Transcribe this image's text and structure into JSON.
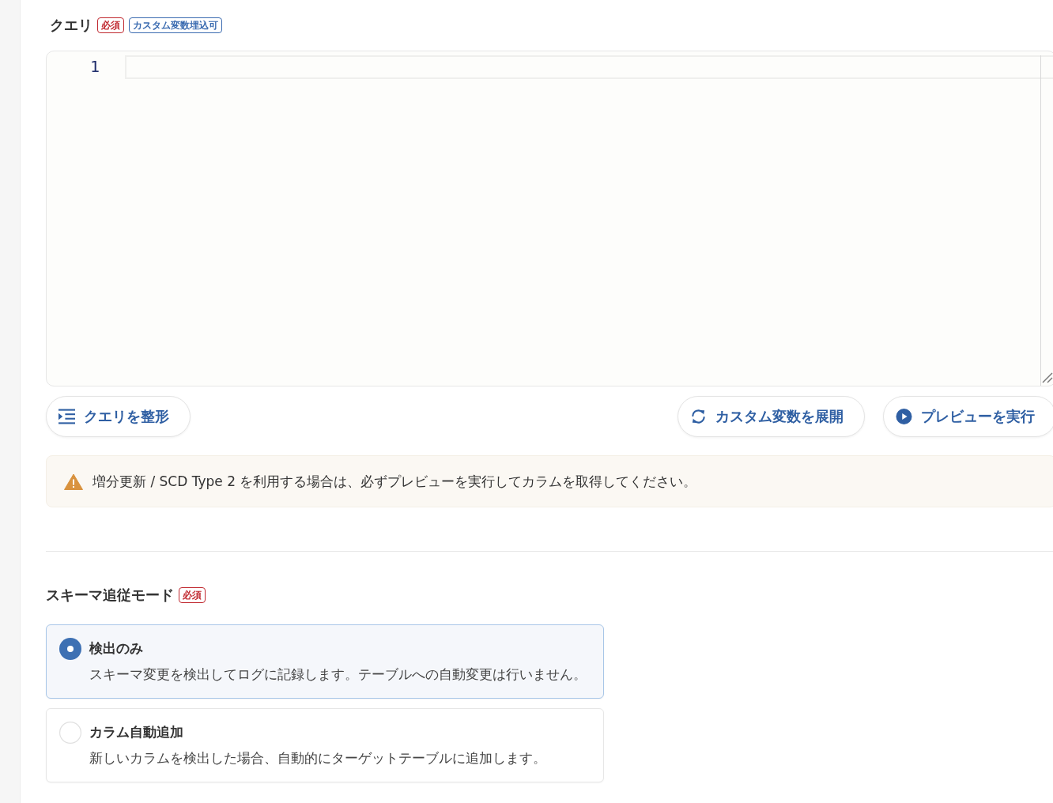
{
  "query_field": {
    "label": "クエリ",
    "badges": [
      {
        "text": "必須",
        "kind": "required"
      },
      {
        "text": "カスタム変数埋込可",
        "kind": "info"
      }
    ],
    "editor": {
      "line_numbers": [
        "1"
      ]
    },
    "buttons": [
      {
        "label": "クエリを整形",
        "kind": "format"
      },
      {
        "label": "カスタム変数を展開",
        "kind": "expand"
      },
      {
        "label": "プレビューを実行",
        "kind": "run"
      }
    ],
    "alert": {
      "text": "増分更新 / SCD Type 2 を利用する場合は、必ずプレビューを実行してカラムを取得してください。"
    }
  },
  "schema_mode_field": {
    "label": "スキーマ追従モード",
    "badges": [
      {
        "text": "必須",
        "kind": "required"
      }
    ],
    "options": [
      {
        "title": "検出のみ",
        "description": "スキーマ変更を検出してログに記録します。テーブルへの自動変更は行いません。",
        "selected": true
      },
      {
        "title": "カラム自動追加",
        "description": "新しいカラムを検出した場合、自動的にターゲットテーブルに追加します。",
        "selected": false
      }
    ]
  }
}
